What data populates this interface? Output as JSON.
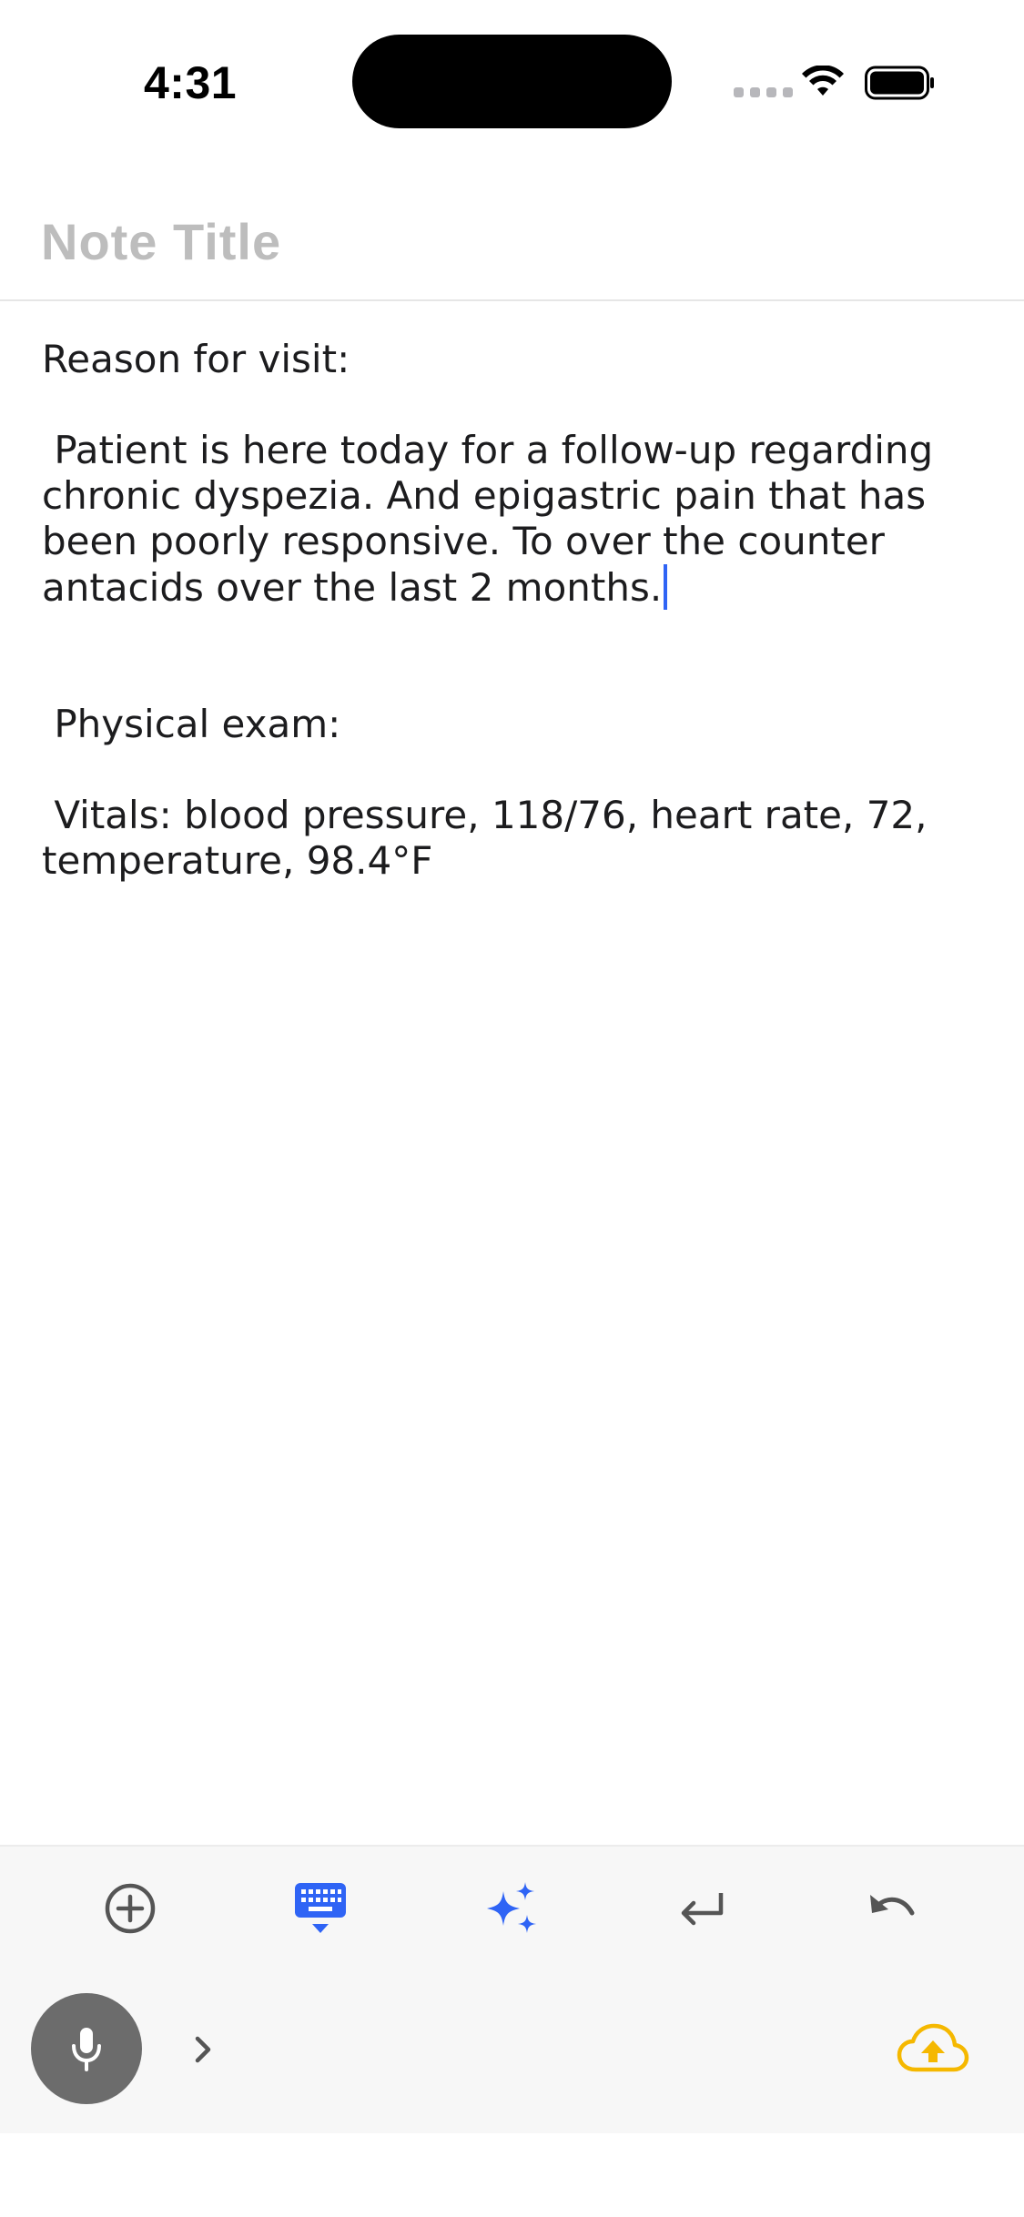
{
  "status_bar": {
    "time": "4:31",
    "icons": [
      "signal-dots-icon",
      "wifi-icon",
      "battery-icon"
    ]
  },
  "note": {
    "title_value": "",
    "title_placeholder": "Note Title",
    "paragraphs": [
      "Reason for visit:",
      " Patient is here today for a follow-up regarding chronic dyspezia. And epigastric pain that has been poorly responsive. To over the counter antacids over the last 2 months.",
      " Physical exam:",
      " Vitals: blood pressure, 118/76, heart rate, 72, temperature, 98.4°F"
    ]
  },
  "toolbar": {
    "buttons": [
      {
        "icon": "add-circle-icon"
      },
      {
        "icon": "keyboard-hide-icon",
        "active": true
      },
      {
        "icon": "sparkles-icon"
      },
      {
        "icon": "return-icon"
      },
      {
        "icon": "undo-icon"
      }
    ]
  },
  "bottom_bar": {
    "icons": [
      "microphone-icon",
      "chevron-right-icon",
      "cloud-upload-icon"
    ]
  },
  "colors": {
    "accent": "#2F64F5",
    "placeholder": "#BDBDBD",
    "upload": "#F5B800",
    "mic_bg": "#6C6C6C"
  }
}
